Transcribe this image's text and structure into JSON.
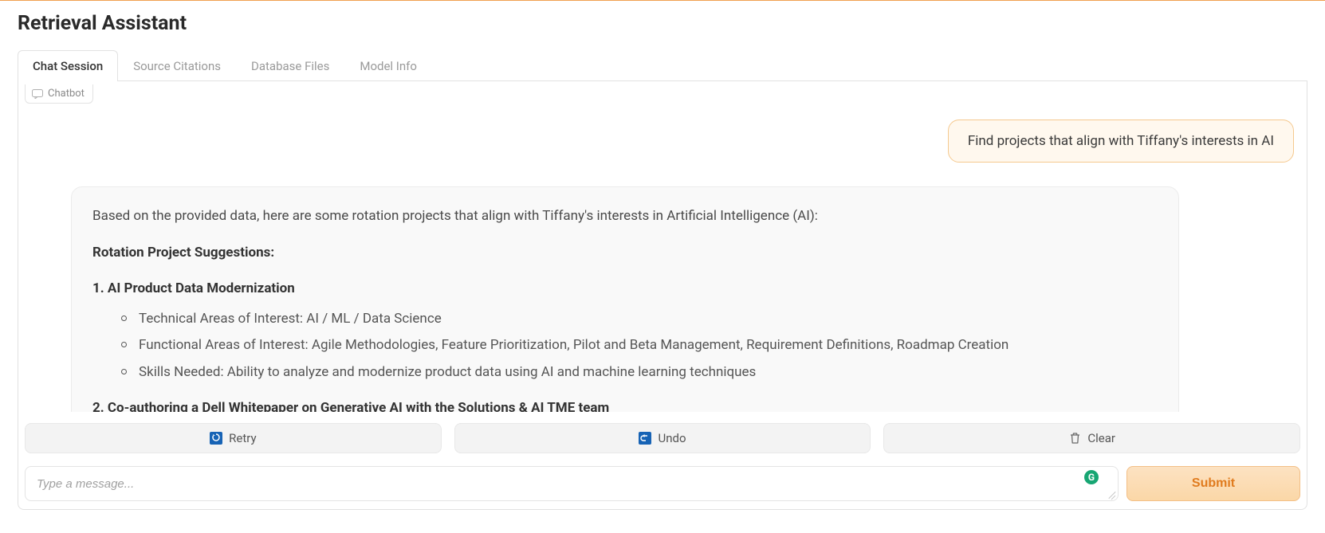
{
  "title": "Retrieval Assistant",
  "tabs": {
    "chat": "Chat Session",
    "citations": "Source Citations",
    "files": "Database Files",
    "model": "Model Info"
  },
  "chip": {
    "label": "Chatbot"
  },
  "chat": {
    "user_message": "Find projects that align with Tiffany's interests in AI",
    "bot": {
      "intro": "Based on the provided data, here are some rotation projects that align with Tiffany's interests in Artificial Intelligence (AI):",
      "section_heading": "Rotation Project Suggestions:",
      "item1_title": "1. AI Product Data Modernization",
      "item1_bullets": {
        "b1": "Technical Areas of Interest: AI / ML / Data Science",
        "b2": "Functional Areas of Interest: Agile Methodologies, Feature Prioritization, Pilot and Beta Management, Requirement Definitions, Roadmap Creation",
        "b3": "Skills Needed: Ability to analyze and modernize product data using AI and machine learning techniques"
      },
      "item2_title": "2. Co-authoring a Dell Whitepaper on Generative AI with the Solutions & AI TME team"
    }
  },
  "actions": {
    "retry": "Retry",
    "undo": "Undo",
    "clear": "Clear"
  },
  "input": {
    "placeholder": "Type a message...",
    "grammarly_badge": "G",
    "submit": "Submit"
  }
}
